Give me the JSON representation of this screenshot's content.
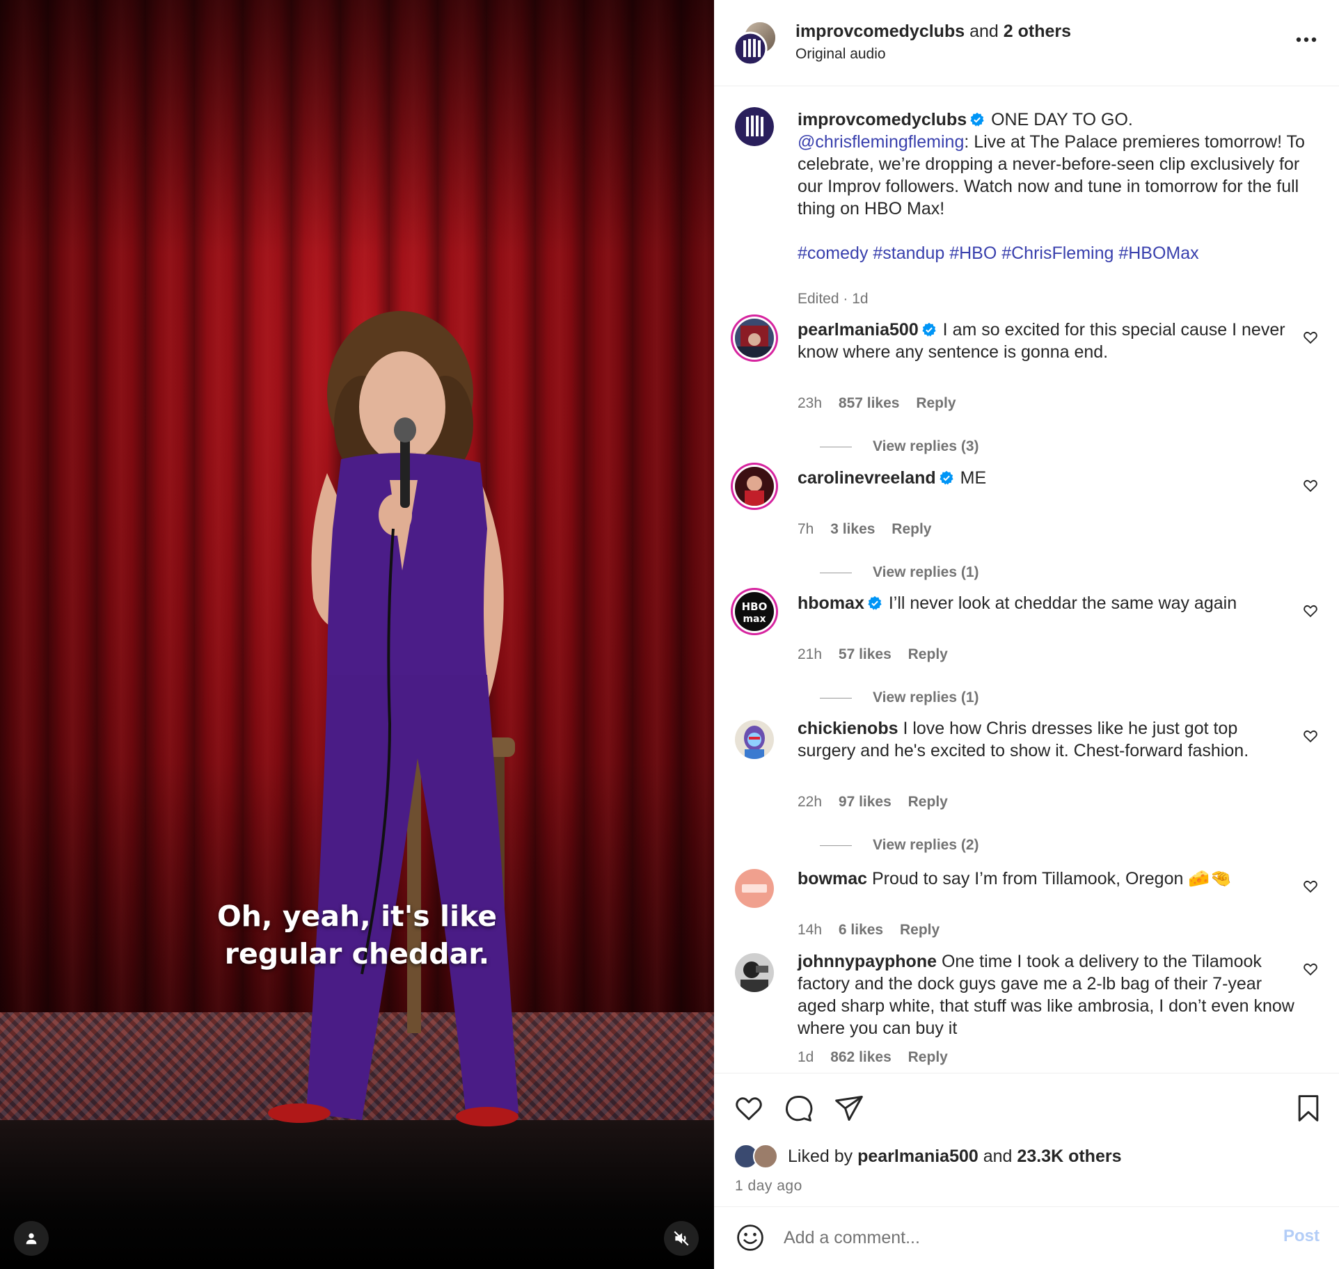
{
  "video": {
    "subtitle_line1": "Oh, yeah, it's like",
    "subtitle_line2": "regular cheddar."
  },
  "header": {
    "username": "improvcomedyclubs",
    "and_text": "and",
    "others": "2 others",
    "audio": "Original audio"
  },
  "caption": {
    "username": "improvcomedyclubs",
    "line1": "ONE DAY TO GO.",
    "mention": "@chrisflemingfleming",
    "text_rest": ": Live at The Palace premieres tomorrow! To celebrate, we’re dropping a never-before-seen clip exclusively for our Improv followers. Watch now and tune in tomorrow for the full thing on HBO Max!",
    "hashtags": "#comedy #standup #HBO #ChrisFleming #HBOMax",
    "edited": "Edited · 1d"
  },
  "comments": [
    {
      "username": "pearlmania500",
      "verified": true,
      "text": "I am so excited for this special cause I never know where any sentence is gonna end.",
      "time": "23h",
      "likes": "857 likes",
      "reply": "Reply",
      "view_replies": "View replies (3)"
    },
    {
      "username": "carolinevreeland",
      "verified": true,
      "text": "ME",
      "time": "7h",
      "likes": "3 likes",
      "reply": "Reply",
      "view_replies": "View replies (1)"
    },
    {
      "username": "hbomax",
      "verified": true,
      "text": "I’ll never look at cheddar the same way again",
      "time": "21h",
      "likes": "57 likes",
      "reply": "Reply",
      "view_replies": "View replies (1)"
    },
    {
      "username": "chickienobs",
      "verified": false,
      "text": "I love how Chris dresses like he just got top surgery and he's excited to show it. Chest-forward fashion.",
      "time": "22h",
      "likes": "97 likes",
      "reply": "Reply",
      "view_replies": "View replies (2)"
    },
    {
      "username": "bowmac",
      "verified": false,
      "text": "Proud to say I’m from Tillamook, Oregon 🧀🤏",
      "time": "14h",
      "likes": "6 likes",
      "reply": "Reply"
    },
    {
      "username": "johnnypayphone",
      "verified": false,
      "text": "One time I took a delivery to the Tilamook factory and the dock guys gave me a 2-lb bag of their 7-year aged sharp white, that stuff was like ambrosia, I don’t even know where you can buy it",
      "time": "1d",
      "likes": "862 likes",
      "reply": "Reply"
    }
  ],
  "footer": {
    "liked_by": "Liked by",
    "liked_user": "pearlmania500",
    "and_text": "and",
    "liked_others": "23.3K others",
    "posted_ago": "1 day ago",
    "add_comment_placeholder": "Add a comment...",
    "post_label": "Post"
  },
  "colors": {
    "verified": "#0095f6",
    "link": "#3940ad",
    "post_disabled": "#b3cdf7",
    "story_ring": "#d6249f"
  },
  "icons": [
    "user-icon",
    "muted-speaker-icon",
    "more-icon",
    "heart-icon",
    "comment-icon",
    "share-icon",
    "bookmark-icon",
    "emoji-icon",
    "verified-icon"
  ]
}
